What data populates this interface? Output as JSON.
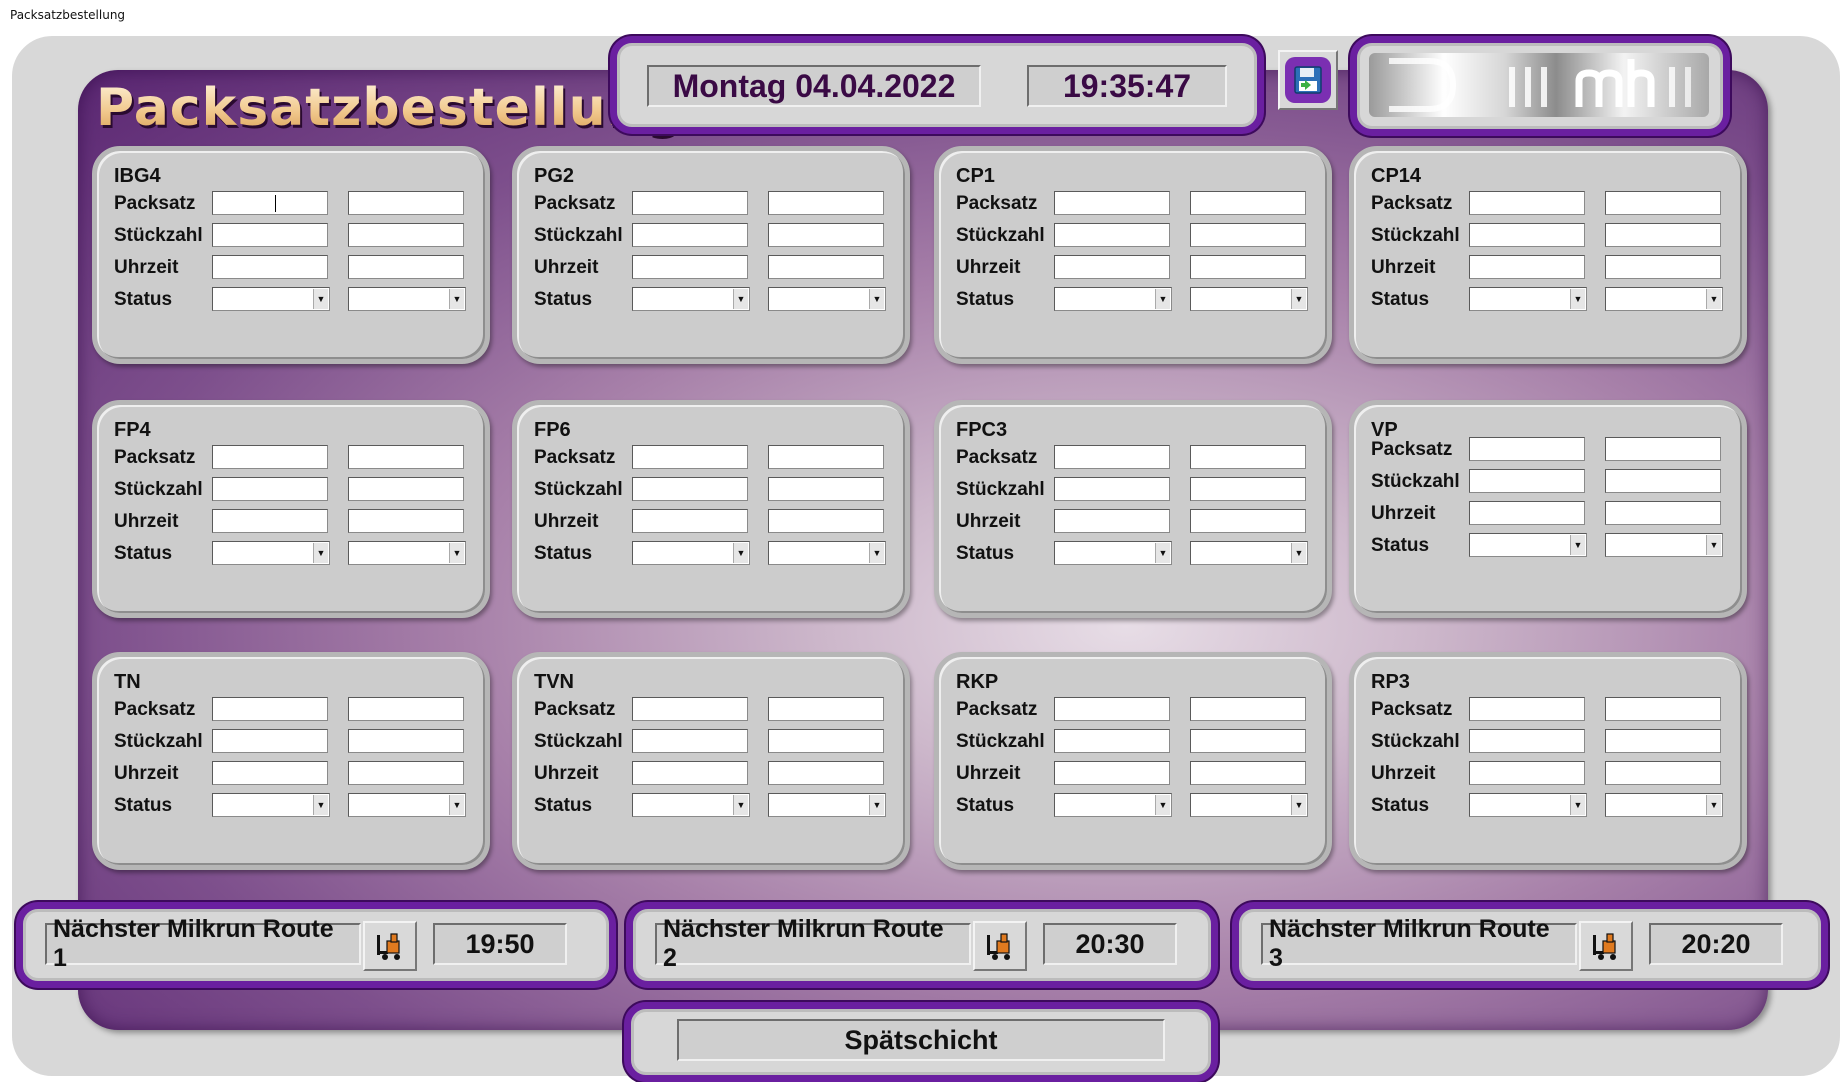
{
  "window": {
    "title": "Packsatzbestellung"
  },
  "app": {
    "title": "Packsatzbestellung"
  },
  "header": {
    "date": "Montag 04.04.2022",
    "time": "19:35:47",
    "save_icon": "save-floppy-icon"
  },
  "labels": {
    "packsatz": "Packsatz",
    "stueckzahl": "Stückzahl",
    "uhrzeit": "Uhrzeit",
    "status": "Status"
  },
  "stations": [
    {
      "name": "IBG4"
    },
    {
      "name": "PG2"
    },
    {
      "name": "CP1"
    },
    {
      "name": "CP14"
    },
    {
      "name": "FP4"
    },
    {
      "name": "FP6"
    },
    {
      "name": "FPC3"
    },
    {
      "name": "VP"
    },
    {
      "name": "TN"
    },
    {
      "name": "TVN"
    },
    {
      "name": "RKP"
    },
    {
      "name": "RP3"
    }
  ],
  "milkrun": [
    {
      "label": "Nächster Milkrun Route 1",
      "time": "19:50",
      "icon": "forklift-icon"
    },
    {
      "label": "Nächster Milkrun Route 2",
      "time": "20:30",
      "icon": "forklift-icon"
    },
    {
      "label": "Nächster Milkrun Route 3",
      "time": "20:20",
      "icon": "forklift-icon"
    }
  ],
  "shift": "Spätschicht",
  "colors": {
    "accent": "#6a1fa0",
    "panel": "#7d4f8c",
    "card": "#cccccc"
  }
}
